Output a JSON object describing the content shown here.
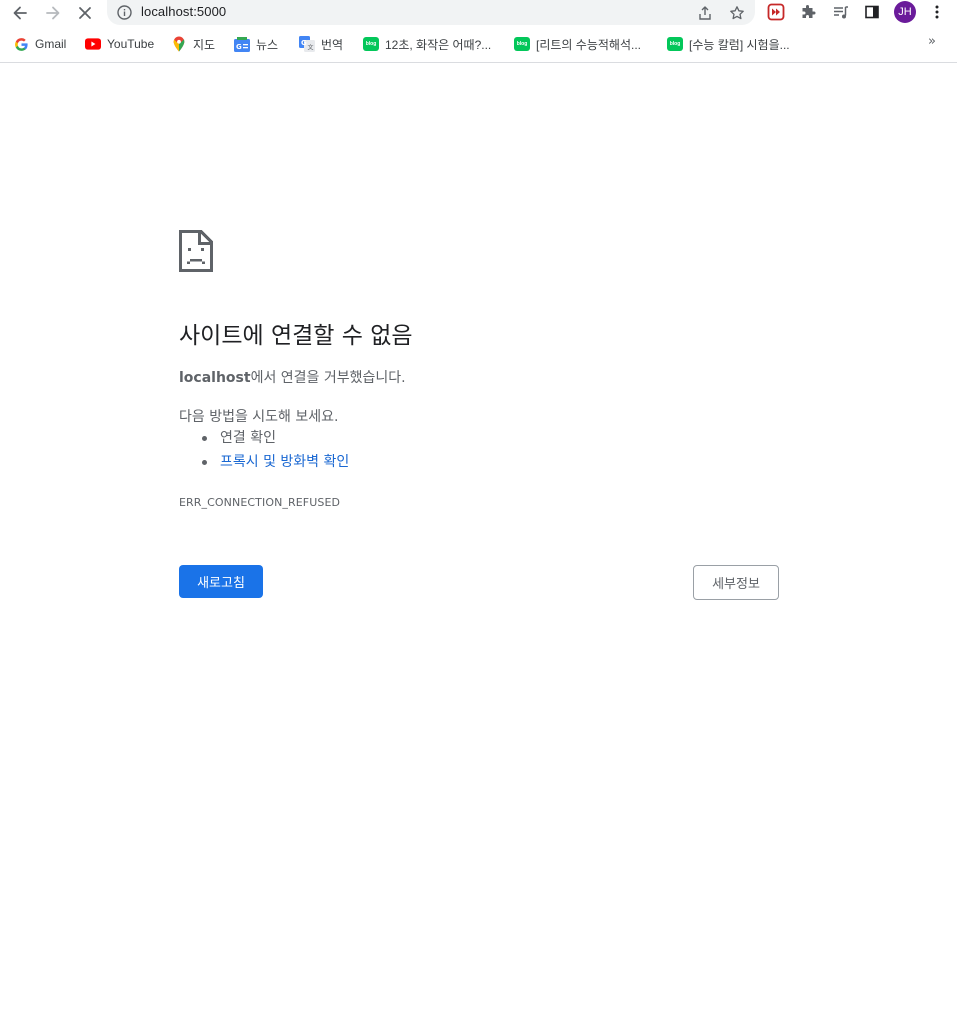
{
  "browser": {
    "url": "localhost:5000",
    "profile_initials": "JH",
    "accent_color": "#1a73e8"
  },
  "bookmarks": {
    "items": [
      {
        "label": "Gmail",
        "icon": "google-icon"
      },
      {
        "label": "YouTube",
        "icon": "youtube-icon"
      },
      {
        "label": "지도",
        "icon": "maps-pin-icon"
      },
      {
        "label": "뉴스",
        "icon": "news-icon"
      },
      {
        "label": "번역",
        "icon": "translate-icon"
      },
      {
        "label": "12초, 화작은 어때?...",
        "icon": "blog-icon"
      },
      {
        "label": "[리트의 수능적해석...",
        "icon": "blog-icon"
      },
      {
        "label": "[수능 칼럼] 시험을...",
        "icon": "blog-icon"
      }
    ],
    "overflow_label": "»"
  },
  "error": {
    "title": "사이트에 연결할 수 없음",
    "host": "localhost",
    "message_suffix": "에서 연결을 거부했습니다.",
    "suggest_heading": "다음 방법을 시도해 보세요.",
    "suggestions": [
      {
        "label": "연결 확인",
        "link": false
      },
      {
        "label": "프록시 및 방화벽 확인",
        "link": true
      }
    ],
    "code": "ERR_CONNECTION_REFUSED",
    "reload_label": "새로고침",
    "details_label": "세부정보"
  }
}
